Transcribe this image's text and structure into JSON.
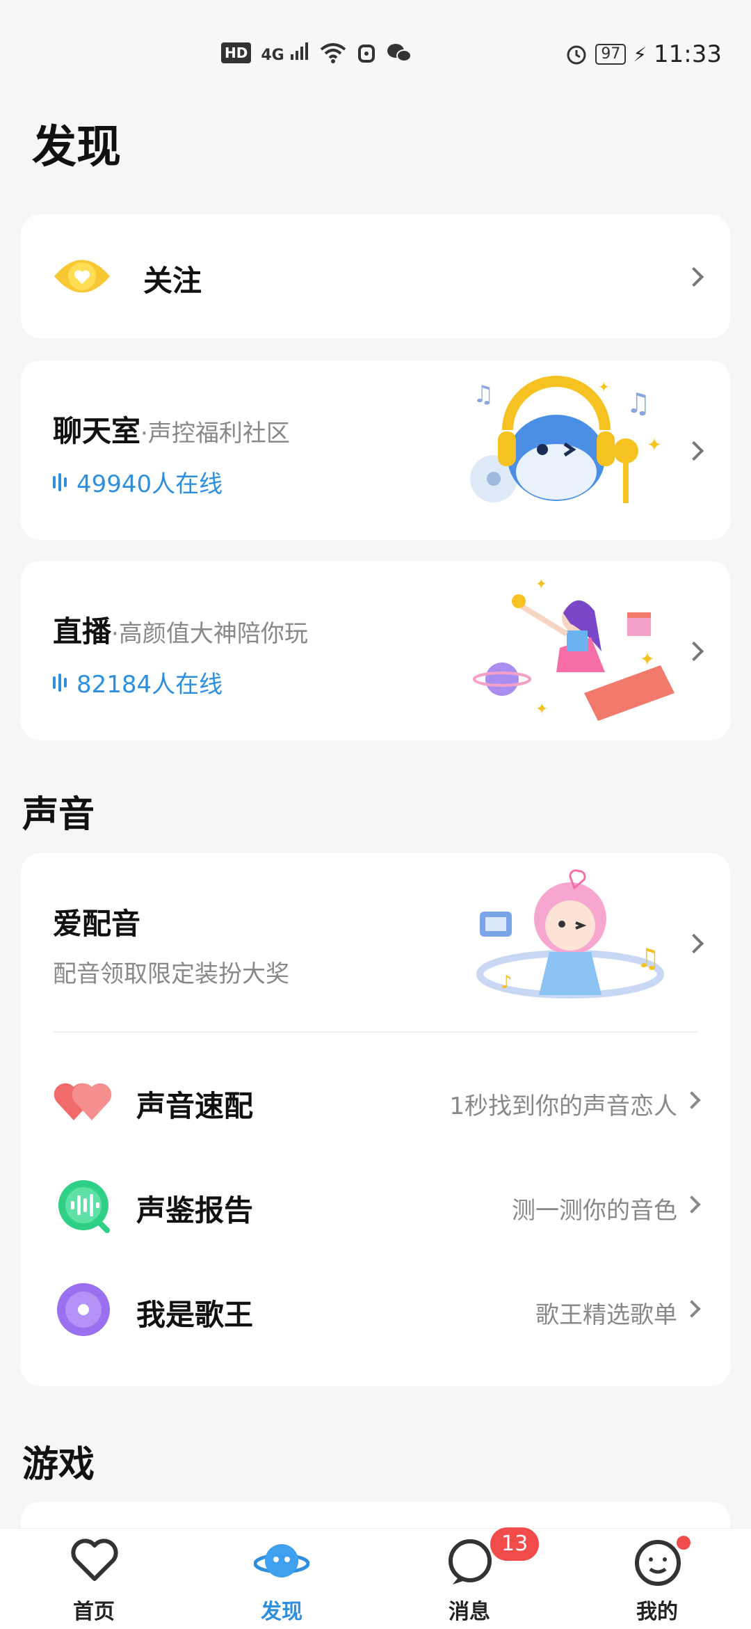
{
  "status_bar": {
    "hd": "HD",
    "network": "4G",
    "battery": "97",
    "time": "11:33"
  },
  "page_title": "发现",
  "follow_card": {
    "label": "关注"
  },
  "chatroom_card": {
    "title": "聊天室",
    "subtitle": "·声控福利社区",
    "online": "49940人在线"
  },
  "live_card": {
    "title": "直播",
    "subtitle": "·高颜值大神陪你玩",
    "online": "82184人在线"
  },
  "sound_section": {
    "title": "声音",
    "dub": {
      "title": "爱配音",
      "desc": "配音领取限定装扮大奖"
    },
    "items": [
      {
        "label": "声音速配",
        "desc": "1秒找到你的声音恋人",
        "icon": "heart-icon"
      },
      {
        "label": "声鉴报告",
        "desc": "测一测你的音色",
        "icon": "voice-wave-icon"
      },
      {
        "label": "我是歌王",
        "desc": "歌王精选歌单",
        "icon": "vinyl-disc-icon"
      }
    ]
  },
  "games_section": {
    "title": "游戏"
  },
  "tabbar": {
    "tabs": [
      {
        "label": "首页"
      },
      {
        "label": "发现"
      },
      {
        "label": "消息"
      },
      {
        "label": "我的"
      }
    ],
    "messages_badge": "13",
    "active_color": "#2f8fdf"
  }
}
